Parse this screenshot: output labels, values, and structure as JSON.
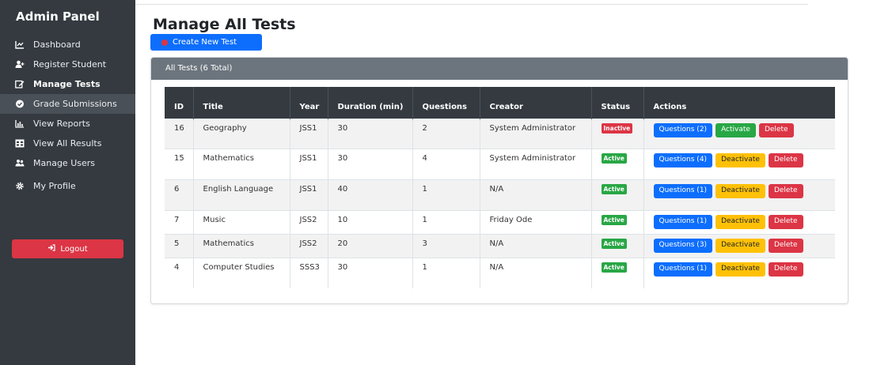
{
  "sidebar": {
    "title": "Admin Panel",
    "items": [
      {
        "label": "Dashboard",
        "icon": "chart-line-icon"
      },
      {
        "label": "Register Student",
        "icon": "user-plus-icon"
      },
      {
        "label": "Manage Tests",
        "icon": "edit-icon"
      },
      {
        "label": "Grade Submissions",
        "icon": "check-circle-icon"
      },
      {
        "label": "View Reports",
        "icon": "bar-chart-icon"
      },
      {
        "label": "View All Results",
        "icon": "table-icon"
      },
      {
        "label": "Manage Users",
        "icon": "users-icon"
      },
      {
        "label": "My Profile",
        "icon": "gear-icon"
      }
    ],
    "logout_label": "Logout"
  },
  "main": {
    "title": "Manage All Tests",
    "create_label": "Create New Test",
    "card_header": "All Tests (6 Total)",
    "table": {
      "headers": [
        "ID",
        "Title",
        "Year",
        "Duration (min)",
        "Questions",
        "Creator",
        "Status",
        "Actions"
      ],
      "rows": [
        {
          "id": "16",
          "title": "Geography",
          "year": "JSS1",
          "duration": "30",
          "questions": "2",
          "creator": "System Administrator",
          "status": "Inactive",
          "q_btn": "Questions (2)",
          "toggle_btn": "Activate",
          "delete_btn": "Delete"
        },
        {
          "id": "15",
          "title": "Mathematics",
          "year": "JSS1",
          "duration": "30",
          "questions": "4",
          "creator": "System Administrator",
          "status": "Active",
          "q_btn": "Questions (4)",
          "toggle_btn": "Deactivate",
          "delete_btn": "Delete"
        },
        {
          "id": "6",
          "title": "English Language",
          "year": "JSS1",
          "duration": "40",
          "questions": "1",
          "creator": "N/A",
          "status": "Active",
          "q_btn": "Questions (1)",
          "toggle_btn": "Deactivate",
          "delete_btn": "Delete"
        },
        {
          "id": "7",
          "title": "Music",
          "year": "JSS2",
          "duration": "10",
          "questions": "1",
          "creator": "Friday Ode",
          "status": "Active",
          "q_btn": "Questions (1)",
          "toggle_btn": "Deactivate",
          "delete_btn": "Delete"
        },
        {
          "id": "5",
          "title": "Mathematics",
          "year": "JSS2",
          "duration": "20",
          "questions": "3",
          "creator": "N/A",
          "status": "Active",
          "q_btn": "Questions (3)",
          "toggle_btn": "Deactivate",
          "delete_btn": "Delete"
        },
        {
          "id": "4",
          "title": "Computer Studies",
          "year": "SSS3",
          "duration": "30",
          "questions": "1",
          "creator": "N/A",
          "status": "Active",
          "q_btn": "Questions (1)",
          "toggle_btn": "Deactivate",
          "delete_btn": "Delete"
        }
      ]
    }
  },
  "colors": {
    "sidebar_bg": "#343a40",
    "primary": "#0d6efd",
    "success": "#28a745",
    "warning": "#ffc107",
    "danger": "#dc3545",
    "card_header_bg": "#6c757d"
  }
}
